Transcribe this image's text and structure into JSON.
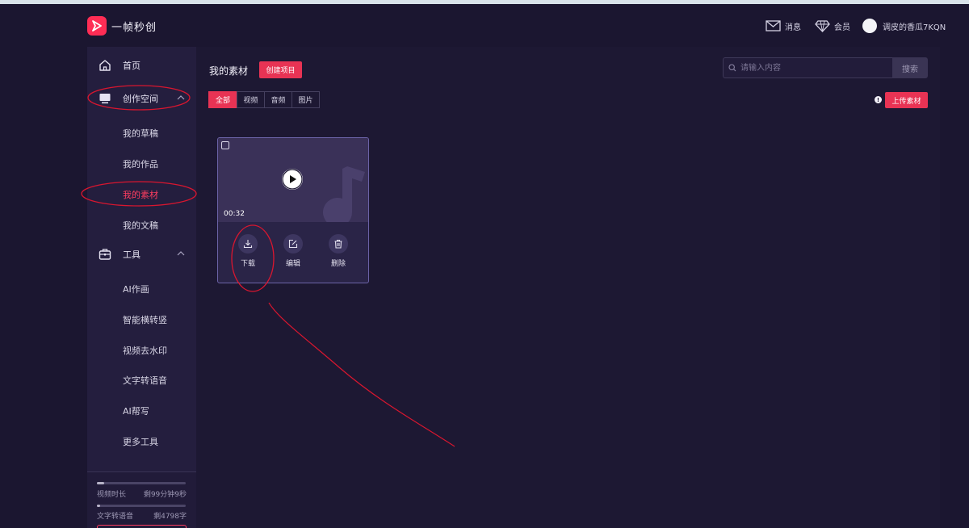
{
  "app": {
    "name": "一帧秒创"
  },
  "header": {
    "messages_label": "消息",
    "member_label": "会员",
    "username": "调皮的香瓜7KQN"
  },
  "sidebar": {
    "home": "首页",
    "creative_space": "创作空间",
    "creative_items": [
      "我的草稿",
      "我的作品",
      "我的素材",
      "我的文稿"
    ],
    "tools": "工具",
    "tool_items": [
      "AI作画",
      "智能横转竖",
      "视频去水印",
      "文字转语音",
      "AI帮写",
      "更多工具"
    ],
    "usage": {
      "video_label": "视频时长",
      "video_remaining": "剩99分钟9秒",
      "video_progress": 0.08,
      "tts_label": "文字转语音",
      "tts_remaining": "剩4798字",
      "tts_progress": 0.04
    }
  },
  "main": {
    "title": "我的素材",
    "create_button": "创建项目",
    "search_placeholder": "请输入内容",
    "search_button": "搜索",
    "tabs": [
      "全部",
      "视频",
      "音频",
      "图片"
    ],
    "active_tab": "全部",
    "upload_button": "上传素材",
    "card": {
      "duration": "00:32",
      "actions": [
        "下载",
        "编辑",
        "删除"
      ]
    }
  },
  "colors": {
    "accent": "#e83354",
    "annotation": "#d9162f",
    "background": "#1b1630"
  }
}
